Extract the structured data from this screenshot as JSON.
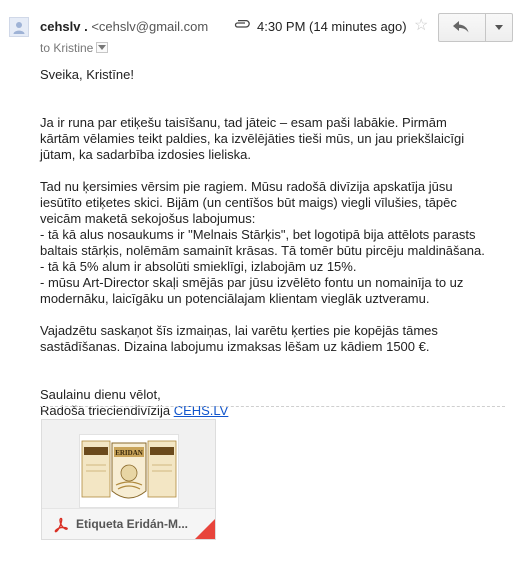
{
  "header": {
    "sender_name": "cehslv .",
    "sender_email": "<cehslv@gmail.com",
    "to_line": "to Kristine",
    "time": "4:30 PM (14 minutes ago)"
  },
  "icons": {
    "avatar": "person-icon",
    "attachment_indicator": "paperclip-icon",
    "star": "star-icon",
    "reply": "reply-icon",
    "more": "chevron-down-icon",
    "file": "pdf-icon"
  },
  "body": {
    "greeting": "Sveika, Kristīne!",
    "p1_l1": "Ja ir runa par etiķešu taisīšanu, tad jāteic – esam paši labākie. Pirmām",
    "p1_l2": "kārtām vēlamies teikt paldies, ka izvēlējāties tieši mūs, un jau priekšlaicīgi",
    "p1_l3": "jūtam, ka sadarbība izdosies lieliska.",
    "p2_l1": "Tad nu ķersimies vērsim pie ragiem. Mūsu radošā divīzija apskatīja jūsu",
    "p2_l2": "iesūtīto etiķetes skici. Bijām (un centīšos būt maigs) viegli vīlušies, tāpēc",
    "p2_l3": "veicām maketā sekojošus labojumus:",
    "p2_l4": "- tā kā alus nosaukums ir \"Melnais Stārķis\", bet logotipā bija attēlots parasts",
    "p2_l5": "baltais stārķis, nolēmām samainīt krāsas. Tā tomēr būtu pircēju maldināšana.",
    "p2_l6": "- tā kā 5% alum ir absolūti smieklīgi, izlabojām uz 15%.",
    "p2_l7": "- mūsu Art-Director skaļi smējās par jūsu izvēlēto fontu un nomainīja to uz",
    "p2_l8": "modernāku, laicīgāku un potenciālajam klientam vieglāk uztveramu.",
    "p3_l1": "Vajadzētu saskaņot šīs izmaiņas, lai varētu ķerties pie kopējās tāmes",
    "p3_l2": "sastādīšanas. Dizaina labojumu izmaksas lēšam uz kādiem 1500 €.",
    "sign_l1": "Saulainu dienu vēlot,",
    "sign_l2_prefix": "Radošā trieciendivīzija ",
    "sign_link": "CEHS.LV"
  },
  "attachment": {
    "name": "Etiqueta Eridán-M...",
    "thumbnail_text": "ERIDAN"
  }
}
